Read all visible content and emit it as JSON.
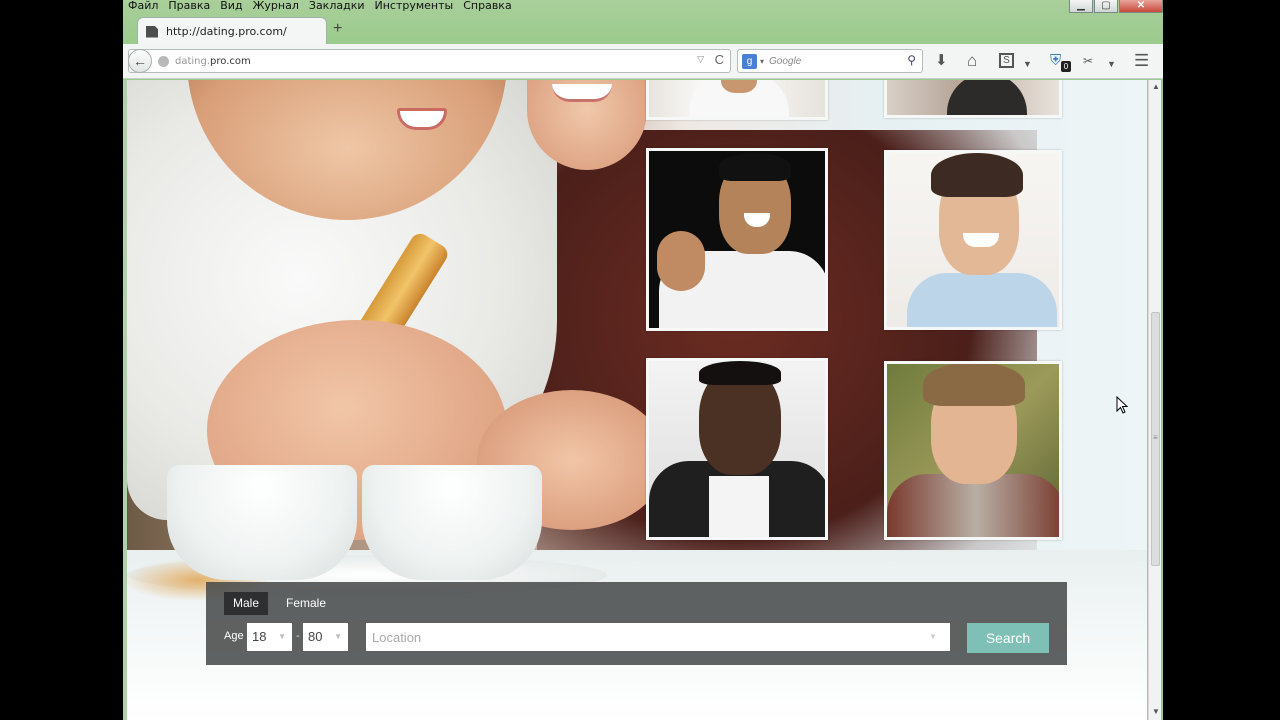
{
  "menubar": [
    "Файл",
    "Правка",
    "Вид",
    "Журнал",
    "Закладки",
    "Инструменты",
    "Справка"
  ],
  "window_controls": {
    "minimize": "▁",
    "maximize": "▢",
    "close": "✕"
  },
  "tab": {
    "title": "http://dating.pro.com/",
    "new_tab": "+"
  },
  "navbar": {
    "back": "←",
    "url_domain": "dating.",
    "url_bold": "pro.com",
    "url_dropdown": "▽",
    "reload": "C",
    "search_placeholder": "Google",
    "search_engine_icon": "g",
    "icons": {
      "download": "⬇",
      "home": "⌂",
      "sync": "S",
      "addon": "⛨",
      "addon_badge": "0",
      "extension": "✂",
      "menu": "☰"
    }
  },
  "search_panel": {
    "tabs": [
      "Male",
      "Female"
    ],
    "age_label": "Age",
    "age_from": "18",
    "age_dash": "-",
    "age_to": "80",
    "location_placeholder": "Location",
    "search_button": "Search"
  },
  "colors": {
    "panel_bg": "#464848",
    "active_tab": "#2e2f30",
    "search_button": "#7fc0b6"
  }
}
